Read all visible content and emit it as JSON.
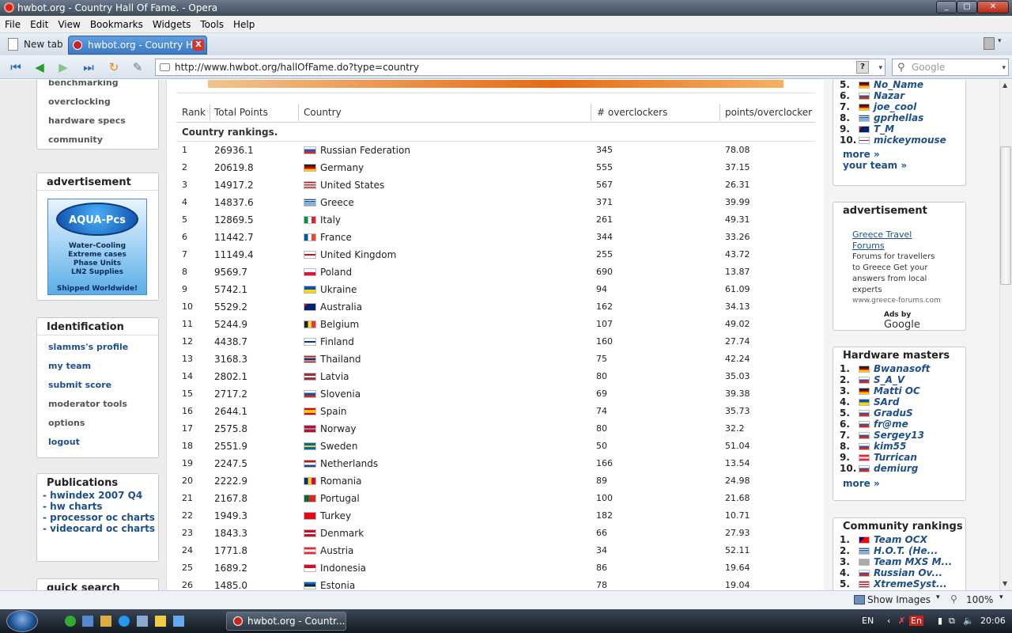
{
  "window": {
    "title": "hwbot.org - Country Hall Of Fame. - Opera"
  },
  "menu": [
    "File",
    "Edit",
    "View",
    "Bookmarks",
    "Widgets",
    "Tools",
    "Help"
  ],
  "tabs": {
    "new_tab": "New tab",
    "active_tab": "hwbot.org - Country H..."
  },
  "address": {
    "url": "http://www.hwbot.org/hallOfFame.do?type=country",
    "search_placeholder": "Google"
  },
  "left": {
    "top_links": [
      "benchmarking",
      "overclocking",
      "hardware specs",
      "community"
    ],
    "ad_title": "advertisement",
    "ad": {
      "brand": "AQUA-Pcs",
      "lines": [
        "Water-Cooling",
        "Extreme cases",
        "Phase Units",
        "LN2 Supplies"
      ],
      "footer": "Shipped Worldwide!"
    },
    "ident_title": "Identification",
    "ident_links": [
      "slamms's profile",
      "my team",
      "submit score",
      "moderator tools",
      "options",
      "logout"
    ],
    "pub_title": "Publications",
    "pubs": [
      "- hwindex 2007 Q4",
      "- hw charts",
      "- processor oc charts",
      "- videocard oc charts"
    ],
    "search_title": "quick search"
  },
  "table": {
    "headers": {
      "rank": "Rank",
      "points": "Total Points",
      "country": "Country",
      "oc": "# overclockers",
      "ppo": "points/overclocker"
    },
    "caption": "Country rankings.",
    "rows": [
      {
        "rank": "1",
        "points": "26936.1",
        "country": "Russian Federation",
        "oc": "345",
        "ppo": "78.08",
        "flag": "ru"
      },
      {
        "rank": "2",
        "points": "20619.8",
        "country": "Germany",
        "oc": "555",
        "ppo": "37.15",
        "flag": "de"
      },
      {
        "rank": "3",
        "points": "14917.2",
        "country": "United States",
        "oc": "567",
        "ppo": "26.31",
        "flag": "us"
      },
      {
        "rank": "4",
        "points": "14837.6",
        "country": "Greece",
        "oc": "371",
        "ppo": "39.99",
        "flag": "gr"
      },
      {
        "rank": "5",
        "points": "12869.5",
        "country": "Italy",
        "oc": "261",
        "ppo": "49.31",
        "flag": "it"
      },
      {
        "rank": "6",
        "points": "11442.7",
        "country": "France",
        "oc": "344",
        "ppo": "33.26",
        "flag": "fr"
      },
      {
        "rank": "7",
        "points": "11149.4",
        "country": "United Kingdom",
        "oc": "255",
        "ppo": "43.72",
        "flag": "gb"
      },
      {
        "rank": "8",
        "points": "9569.7",
        "country": "Poland",
        "oc": "690",
        "ppo": "13.87",
        "flag": "pl"
      },
      {
        "rank": "9",
        "points": "5742.1",
        "country": "Ukraine",
        "oc": "94",
        "ppo": "61.09",
        "flag": "ua"
      },
      {
        "rank": "10",
        "points": "5529.2",
        "country": "Australia",
        "oc": "162",
        "ppo": "34.13",
        "flag": "au"
      },
      {
        "rank": "11",
        "points": "5244.9",
        "country": "Belgium",
        "oc": "107",
        "ppo": "49.02",
        "flag": "be"
      },
      {
        "rank": "12",
        "points": "4438.7",
        "country": "Finland",
        "oc": "160",
        "ppo": "27.74",
        "flag": "fi"
      },
      {
        "rank": "13",
        "points": "3168.3",
        "country": "Thailand",
        "oc": "75",
        "ppo": "42.24",
        "flag": "th"
      },
      {
        "rank": "14",
        "points": "2802.1",
        "country": "Latvia",
        "oc": "80",
        "ppo": "35.03",
        "flag": "lv"
      },
      {
        "rank": "15",
        "points": "2717.2",
        "country": "Slovenia",
        "oc": "69",
        "ppo": "39.38",
        "flag": "si"
      },
      {
        "rank": "16",
        "points": "2644.1",
        "country": "Spain",
        "oc": "74",
        "ppo": "35.73",
        "flag": "es"
      },
      {
        "rank": "17",
        "points": "2575.8",
        "country": "Norway",
        "oc": "80",
        "ppo": "32.2",
        "flag": "no"
      },
      {
        "rank": "18",
        "points": "2551.9",
        "country": "Sweden",
        "oc": "50",
        "ppo": "51.04",
        "flag": "se"
      },
      {
        "rank": "19",
        "points": "2247.5",
        "country": "Netherlands",
        "oc": "166",
        "ppo": "13.54",
        "flag": "nl"
      },
      {
        "rank": "20",
        "points": "2222.9",
        "country": "Romania",
        "oc": "89",
        "ppo": "24.98",
        "flag": "ro"
      },
      {
        "rank": "21",
        "points": "2167.8",
        "country": "Portugal",
        "oc": "100",
        "ppo": "21.68",
        "flag": "pt"
      },
      {
        "rank": "22",
        "points": "1949.3",
        "country": "Turkey",
        "oc": "182",
        "ppo": "10.71",
        "flag": "tr"
      },
      {
        "rank": "23",
        "points": "1843.3",
        "country": "Denmark",
        "oc": "66",
        "ppo": "27.93",
        "flag": "dk"
      },
      {
        "rank": "24",
        "points": "1771.8",
        "country": "Austria",
        "oc": "34",
        "ppo": "52.11",
        "flag": "at"
      },
      {
        "rank": "25",
        "points": "1689.2",
        "country": "Indonesia",
        "oc": "86",
        "ppo": "19.64",
        "flag": "id"
      },
      {
        "rank": "26",
        "points": "1485.0",
        "country": "Estonia",
        "oc": "78",
        "ppo": "19.04",
        "flag": "ee"
      }
    ]
  },
  "right": {
    "top_list": [
      {
        "n": "5.",
        "name": "No_Name",
        "flag": "de"
      },
      {
        "n": "6.",
        "name": "Nazar",
        "flag": "ru"
      },
      {
        "n": "7.",
        "name": "joe_cool",
        "flag": "de"
      },
      {
        "n": "8.",
        "name": "gprhellas",
        "flag": "gr"
      },
      {
        "n": "9.",
        "name": "T_M",
        "flag": "au"
      },
      {
        "n": "10.",
        "name": "mickeymouse",
        "flag": "gb"
      }
    ],
    "top_more": "more »",
    "your_team": "your team »",
    "ad_title": "advertisement",
    "ad_link": "Greece Travel Forums",
    "ad_text": "Forums for travellers to Greece Get your answers from local experts",
    "ad_url": "www.greece-forums.com",
    "ads_by": "Ads by",
    "ads_google": "Google",
    "hw_title": "Hardware masters",
    "hw_list": [
      {
        "n": "1.",
        "name": "Bwanasoft",
        "flag": "de"
      },
      {
        "n": "2.",
        "name": "S_A_V",
        "flag": "ru"
      },
      {
        "n": "3.",
        "name": "Matti OC",
        "flag": "de"
      },
      {
        "n": "4.",
        "name": "SArd",
        "flag": "ua"
      },
      {
        "n": "5.",
        "name": "GraduS",
        "flag": "ru"
      },
      {
        "n": "6.",
        "name": "fr@me",
        "flag": "ru"
      },
      {
        "n": "7.",
        "name": "Sergey13",
        "flag": "ru"
      },
      {
        "n": "8.",
        "name": "kim55",
        "flag": "ru"
      },
      {
        "n": "9.",
        "name": "Turrican",
        "flag": "at"
      },
      {
        "n": "10.",
        "name": "demiurg",
        "flag": "ru"
      }
    ],
    "hw_more": "more »",
    "comm_title": "Community rankings",
    "comm_list": [
      {
        "n": "1.",
        "name": "Team OCX",
        "flag": "tw"
      },
      {
        "n": "2.",
        "name": "H.O.T. (He...",
        "flag": "gr"
      },
      {
        "n": "3.",
        "name": "Team MXS M...",
        "flag": "unknown"
      },
      {
        "n": "4.",
        "name": "Russian Ov...",
        "flag": "ru"
      },
      {
        "n": "5.",
        "name": "XtremeSyst...",
        "flag": "us"
      }
    ]
  },
  "status": {
    "show_images": "Show Images",
    "zoom": "100%"
  },
  "taskbar": {
    "window": "hwbot.org - Countr...",
    "lang": "EN",
    "time": "20:06"
  },
  "colors": {
    "link": "#1e4f8a",
    "active_tab": "#3a78c2"
  }
}
